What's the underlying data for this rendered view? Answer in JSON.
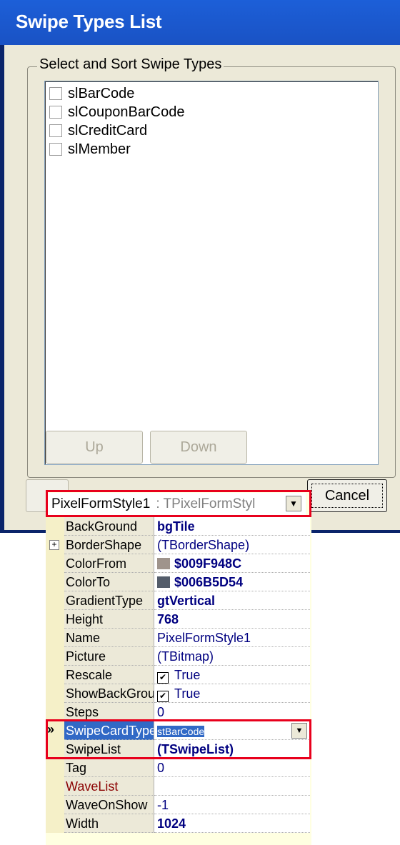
{
  "dialog": {
    "title": "Swipe Types List",
    "group_label": "Select and Sort Swipe Types",
    "items": [
      {
        "label": "slBarCode",
        "checked": false
      },
      {
        "label": "slCouponBarCode",
        "checked": false
      },
      {
        "label": "slCreditCard",
        "checked": false
      },
      {
        "label": "slMember",
        "checked": false
      }
    ],
    "up_label": "Up",
    "down_label": "Down",
    "cancel_label": "Cancel"
  },
  "inspector": {
    "component_name": "PixelFormStyle1",
    "component_type": ": TPixelFormStyl",
    "properties": [
      {
        "name": "BackGround",
        "value": "bgTile"
      },
      {
        "name": "BorderShape",
        "value": "(TBorderShape)"
      },
      {
        "name": "ColorFrom",
        "value": "$009F948C",
        "swatch": "#9f948c"
      },
      {
        "name": "ColorTo",
        "value": "$006B5D54",
        "swatch": "#545d6b"
      },
      {
        "name": "GradientType",
        "value": "gtVertical"
      },
      {
        "name": "Height",
        "value": "768"
      },
      {
        "name": "Name",
        "value": "PixelFormStyle1"
      },
      {
        "name": "Picture",
        "value": "(TBitmap)"
      },
      {
        "name": "Rescale",
        "value": "True",
        "checked": true
      },
      {
        "name": "ShowBackGround",
        "value": "True",
        "checked": true
      },
      {
        "name": "Steps",
        "value": "0"
      },
      {
        "name": "SwipeCardType",
        "value": "stBarCode"
      },
      {
        "name": "SwipeList",
        "value": "(TSwipeList)"
      },
      {
        "name": "Tag",
        "value": "0"
      },
      {
        "name": "WaveList",
        "value": ""
      },
      {
        "name": "WaveOnShow",
        "value": "-1"
      },
      {
        "name": "Width",
        "value": "1024"
      }
    ]
  },
  "colors": {
    "titlebar": "#1c5fd8",
    "highlight_box": "#e8001c",
    "selection": "#3169c6"
  }
}
